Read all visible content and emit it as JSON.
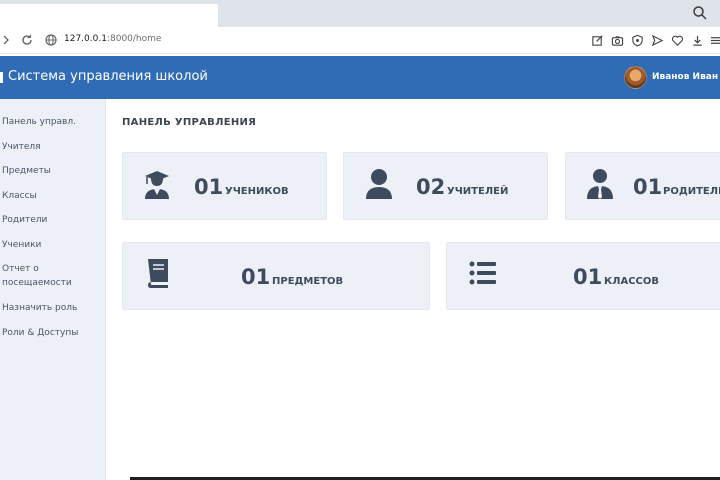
{
  "browser": {
    "url_host": "127.0.0.1",
    "url_path": ":8000/home"
  },
  "header": {
    "title": "Система управления школой",
    "user_name": "Иванов Иван И"
  },
  "sidebar": {
    "items": [
      {
        "label": "Панель управл."
      },
      {
        "label": "Учителя"
      },
      {
        "label": "Предметы"
      },
      {
        "label": "Классы"
      },
      {
        "label": "Родители"
      },
      {
        "label": "Ученики"
      },
      {
        "label": "Отчет о посещаемости"
      },
      {
        "label": "Назначить роль"
      },
      {
        "label": "Роли & Доступы"
      }
    ]
  },
  "main": {
    "title": "ПАНЕЛЬ УПРАВЛЕНИЯ",
    "cards": [
      {
        "count": "01",
        "label": "УЧЕНИКОВ",
        "icon": "graduate-icon"
      },
      {
        "count": "02",
        "label": "УЧИТЕЛЕЙ",
        "icon": "user-icon"
      },
      {
        "count": "01",
        "label": "РОДИТЕЛЕ",
        "icon": "user-tie-icon"
      },
      {
        "count": "01",
        "label": "ПРЕДМЕТОВ",
        "icon": "book-icon"
      },
      {
        "count": "01",
        "label": "КЛАССОВ",
        "icon": "list-icon"
      }
    ]
  },
  "colors": {
    "header": "#2f6cb5",
    "sidebar": "#edf1f7",
    "card": "#edf1f7",
    "icon": "#3e4b5e"
  }
}
